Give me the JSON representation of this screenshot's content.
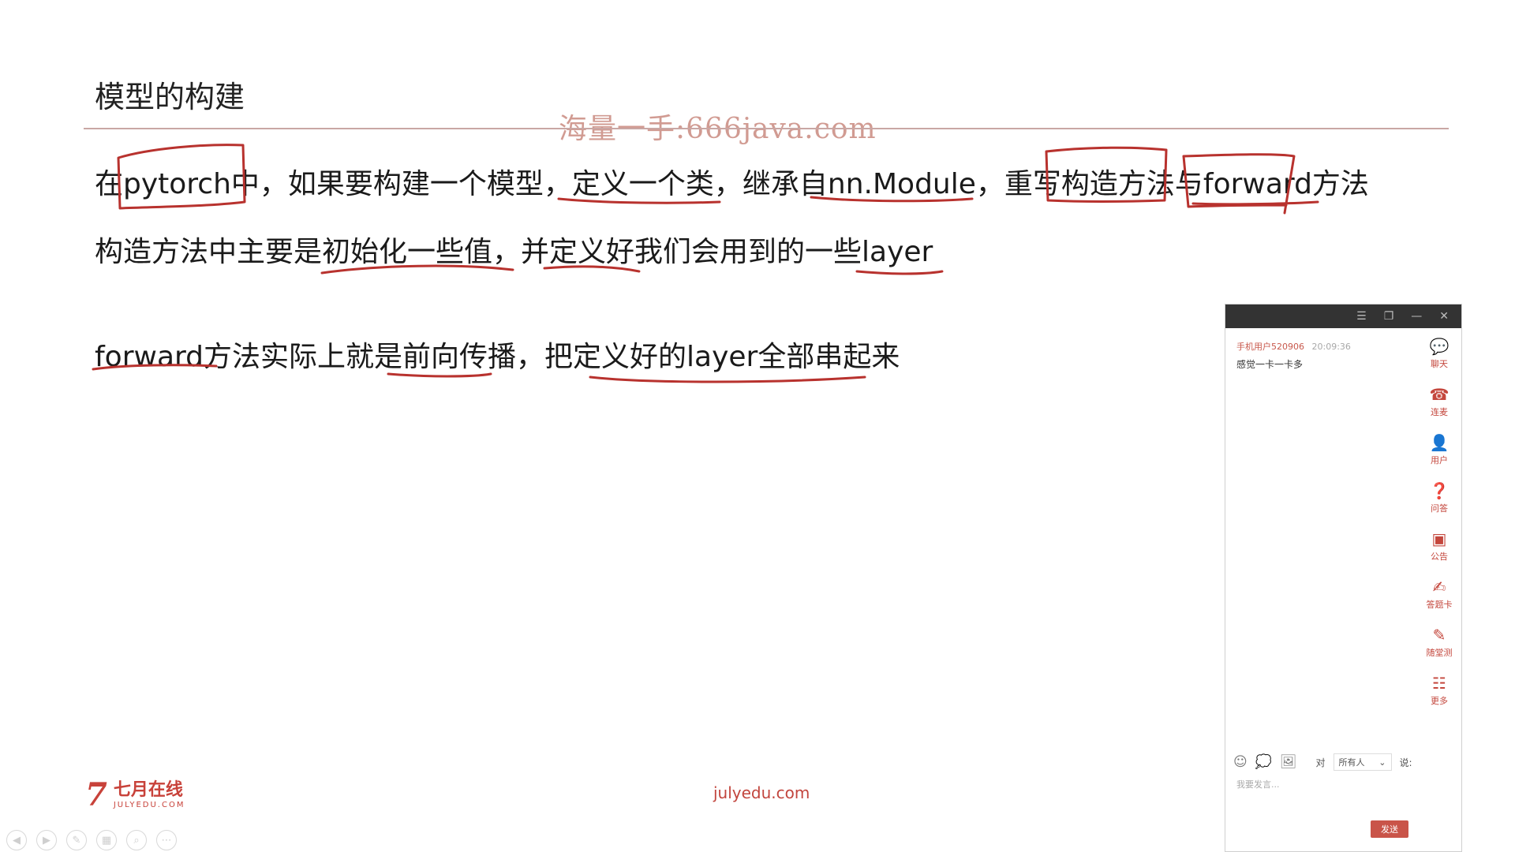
{
  "slide": {
    "title": "模型的构建",
    "watermark": "海量一手:666java.com",
    "lines": [
      "在pytorch中，如果要构建一个模型，定义一个类，继承自nn.Module，重写构造方法与forward方法",
      "构造方法中主要是初始化一些值，并定义好我们会用到的一些layer",
      "forward方法实际上就是前向传播，把定义好的layer全部串起来"
    ],
    "annotation_color": "#b8322e"
  },
  "footer": {
    "logo_mark": "7",
    "logo_cn": "七月在线",
    "logo_en": "JULYEDU.COM",
    "url": "julyedu.com",
    "brand_color": "#c8423a"
  },
  "slide_controls": [
    "prev-icon",
    "next-icon",
    "pen-icon",
    "slides-icon",
    "zoom-icon",
    "more-icon"
  ],
  "chat": {
    "titlebar_icons": [
      "menu-icon",
      "restore-icon",
      "minimize-icon",
      "close-icon"
    ],
    "message": {
      "user": "手机用户520906",
      "time": "20:09:36",
      "text": "感觉一卡一卡多"
    },
    "sidebar": [
      {
        "label": "聊天",
        "icon": "chat-icon"
      },
      {
        "label": "连麦",
        "icon": "phone-icon"
      },
      {
        "label": "用户",
        "icon": "user-icon"
      },
      {
        "label": "问答",
        "icon": "question-icon"
      },
      {
        "label": "公告",
        "icon": "notice-icon"
      },
      {
        "label": "答题卡",
        "icon": "answer-card-icon"
      },
      {
        "label": "随堂测",
        "icon": "quiz-icon"
      },
      {
        "label": "更多",
        "icon": "more-grid-icon"
      }
    ],
    "toolbar": {
      "to_label": "对",
      "recipient": "所有人",
      "say_label": "说:"
    },
    "input_placeholder": "我要发言...",
    "send_label": "发送"
  }
}
